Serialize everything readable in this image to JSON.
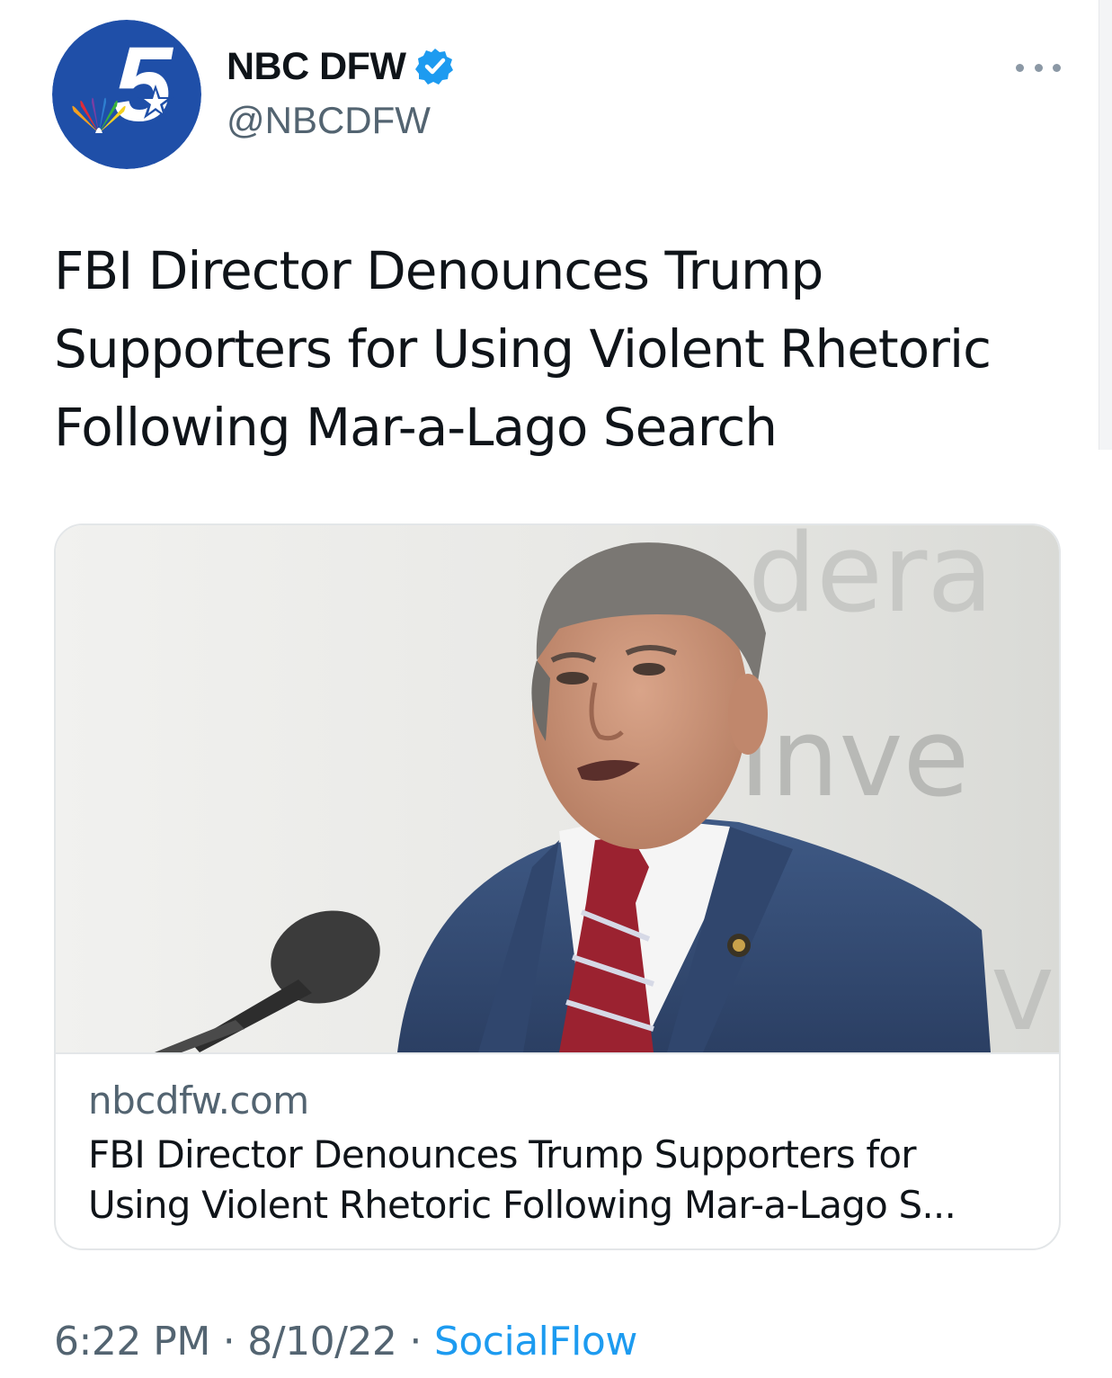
{
  "account": {
    "display_name": "NBC DFW",
    "handle": "@NBCDFW",
    "avatar_badge": "5"
  },
  "tweet": {
    "text": "FBI Director Denounces Trump Supporters for Using Violent Rhetoric Following Mar-a-Lago Search"
  },
  "link_card": {
    "domain": "nbcdfw.com",
    "title": "FBI Director Denounces Trump Supporters for\nUsing Violent Rhetoric Following Mar-a-Lago S...",
    "image_wall_text": {
      "line1": "dera",
      "line2": "Inve",
      "line3": "vi"
    }
  },
  "meta": {
    "time": "6:22 PM",
    "separator": "·",
    "date": "8/10/22",
    "source": "SocialFlow"
  },
  "icons": {
    "verified": "verified-badge-icon",
    "more": "more-options-icon"
  },
  "colors": {
    "link_blue": "#1d9bf0",
    "secondary_text": "#536471",
    "avatar_blue": "#1f4fa8"
  }
}
